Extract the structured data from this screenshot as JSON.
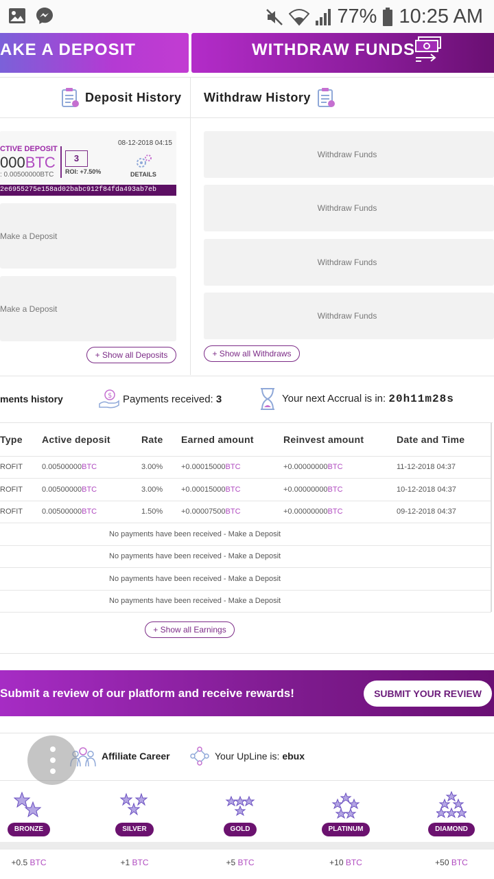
{
  "status_bar": {
    "battery_pct": "77%",
    "time": "10:25 AM",
    "icons": [
      "gallery-icon",
      "messenger-icon",
      "mute-icon",
      "wifi-icon",
      "signal-icon",
      "battery-icon"
    ]
  },
  "top_buttons": {
    "deposit": "AKE A DEPOSIT",
    "withdraw": "WITHDRAW FUNDS"
  },
  "deposit_history": {
    "title": "Deposit History",
    "card": {
      "label": "CTIVE DEPOSIT",
      "amount": "000",
      "unit": "BTC",
      "sub": ": 0.00500000BTC",
      "count": "3",
      "roi": "ROI: +7.50%",
      "date": "08-12-2018 04:15",
      "details": "DETAILS",
      "hash": "2e6955275e158ad02babc912f84fda493ab7eb"
    },
    "placeholders": [
      "Make a Deposit",
      "Make a Deposit"
    ],
    "show_all": "+ Show all Deposits"
  },
  "withdraw_history": {
    "title": "Withdraw History",
    "placeholders": [
      "Withdraw Funds",
      "Withdraw Funds",
      "Withdraw Funds",
      "Withdraw Funds"
    ],
    "show_all": "+ Show all Withdraws"
  },
  "payments": {
    "title": "ments history",
    "received_label": "Payments received:",
    "received_value": "3",
    "accrual_label": "Your next Accrual is in:",
    "accrual_value": "20h11m28s"
  },
  "table": {
    "headers": [
      "Type",
      "Active deposit",
      "Rate",
      "Earned amount",
      "Reinvest amount",
      "Date and Time"
    ],
    "rows": [
      {
        "type": "ROFIT",
        "deposit": "0.00500000",
        "rate": "3.00%",
        "earned": "+0.00015000",
        "reinvest": "+0.00000000",
        "date": "11-12-2018 04:37"
      },
      {
        "type": "ROFIT",
        "deposit": "0.00500000",
        "rate": "3.00%",
        "earned": "+0.00015000",
        "reinvest": "+0.00000000",
        "date": "10-12-2018 04:37"
      },
      {
        "type": "ROFIT",
        "deposit": "0.00500000",
        "rate": "1.50%",
        "earned": "+0.00007500",
        "reinvest": "+0.00000000",
        "date": "09-12-2018 04:37"
      }
    ],
    "currency": "BTC",
    "empty_rows": [
      "No payments have been received - Make a Deposit",
      "No payments have been received - Make a Deposit",
      "No payments have been received - Make a Deposit",
      "No payments have been received - Make a Deposit"
    ],
    "show_all": "+ Show all Earnings"
  },
  "review": {
    "text": "Submit a review of our platform and receive rewards!",
    "button": "SUBMIT YOUR REVIEW"
  },
  "affiliate": {
    "career": "Affiliate Career",
    "upline_label": "Your UpLine is:",
    "upline_value": "ebux"
  },
  "ranks": [
    {
      "name": "BRONZE",
      "bonus": "+0.5",
      "stars": 2
    },
    {
      "name": "SILVER",
      "bonus": "+1",
      "stars": 3
    },
    {
      "name": "GOLD",
      "bonus": "+5",
      "stars": 4
    },
    {
      "name": "PLATINUM",
      "bonus": "+10",
      "stars": 5
    },
    {
      "name": "DIAMOND",
      "bonus": "+50",
      "stars": 6
    }
  ],
  "colors": {
    "accent": "#b04bc0",
    "primary_dark": "#6b126f",
    "brand_gradient_start": "#a62cc4"
  }
}
